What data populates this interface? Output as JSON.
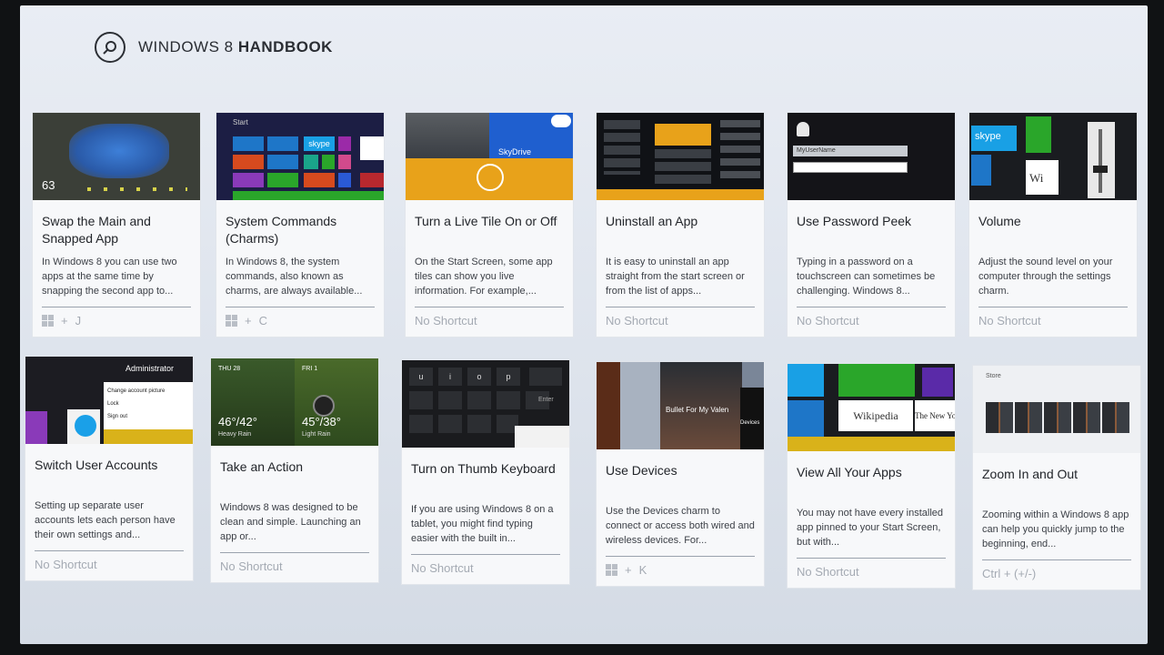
{
  "header": {
    "title_light": "WINDOWS 8",
    "title_bold": "HANDBOOK",
    "search_icon": "search-icon"
  },
  "tiles": [
    {
      "title": "Swap the Main and Snapped App",
      "desc": "In Windows 8 you can use two apps at the same time by snapping the second app to...",
      "shortcut_key": "J",
      "has_win": true
    },
    {
      "title": "System Commands (Charms)",
      "desc": "In Windows 8, the system commands, also known as charms, are always available...",
      "shortcut_key": "C",
      "has_win": true
    },
    {
      "title": "Turn a Live Tile On or Off",
      "desc": "On the Start Screen, some app tiles can show you live information. For example,...",
      "shortcut": "No Shortcut"
    },
    {
      "title": "Uninstall an App",
      "desc": "It is easy to uninstall an app straight from the start screen or from the list of apps...",
      "shortcut": "No Shortcut"
    },
    {
      "title": "Use Password Peek",
      "desc": "Typing in a password on a touchscreen can sometimes be challenging. Windows 8...",
      "shortcut": "No Shortcut"
    },
    {
      "title": "Volume",
      "desc": "Adjust the sound level on your computer through the settings charm.",
      "shortcut": "No Shortcut"
    },
    {
      "title": "Switch User Accounts",
      "desc": "Setting up separate user accounts lets each person have their own settings and...",
      "shortcut": "No Shortcut"
    },
    {
      "title": "Take an Action",
      "desc": "Windows 8 was designed to be clean and simple. Launching an app or...",
      "shortcut": "No Shortcut"
    },
    {
      "title": "Turn on Thumb Keyboard",
      "desc": "If you are using Windows 8 on a tablet, you might find typing easier with the built in...",
      "shortcut": "No Shortcut"
    },
    {
      "title": "Use Devices",
      "desc": "Use the Devices charm to connect or access both wired and wireless devices. For...",
      "shortcut_key": "K",
      "has_win": true
    },
    {
      "title": "View All Your Apps",
      "desc": "You may not have every installed app pinned to your Start Screen, but with...",
      "shortcut": "No Shortcut"
    },
    {
      "title": "Zoom In and Out",
      "desc": "Zooming within a Windows 8 app can help you quickly jump to the beginning, end...",
      "shortcut": "Ctrl + (+/-)"
    }
  ],
  "thumb_text": {
    "t1_time": "63",
    "t2_label": "Start",
    "t2_skype": "skype",
    "t3_skydrive": "SkyDrive",
    "t6_skype": "skype",
    "t6_wiki": "Wi",
    "t7_admin": "Administrator",
    "t7_m1": "Change account picture",
    "t7_m2": "Lock",
    "t7_m3": "Sign out",
    "t8_day1": "THU 28",
    "t8_day2": "FRI 1",
    "t8_temp1": "46°/42°",
    "t8_temp2": "45°/38°",
    "t8_desc1": "Heavy Rain",
    "t8_desc2": "Light Rain",
    "t9_keys": [
      "u",
      "i",
      "o",
      "p"
    ],
    "t9_enter": "Enter",
    "t10_movie": "Bullet For My Valen",
    "t10_devices": "Devices",
    "t11_wiki": "Wikipedia",
    "t11_nyt": "The New Yo",
    "t12_store": "Store",
    "t5_user": "MyUserName"
  },
  "plus_sign": "+",
  "colors": {
    "orange": "#e8a21a",
    "blue": "#1e76c8",
    "green": "#3aa935",
    "skydrive": "#1f5fcf"
  }
}
